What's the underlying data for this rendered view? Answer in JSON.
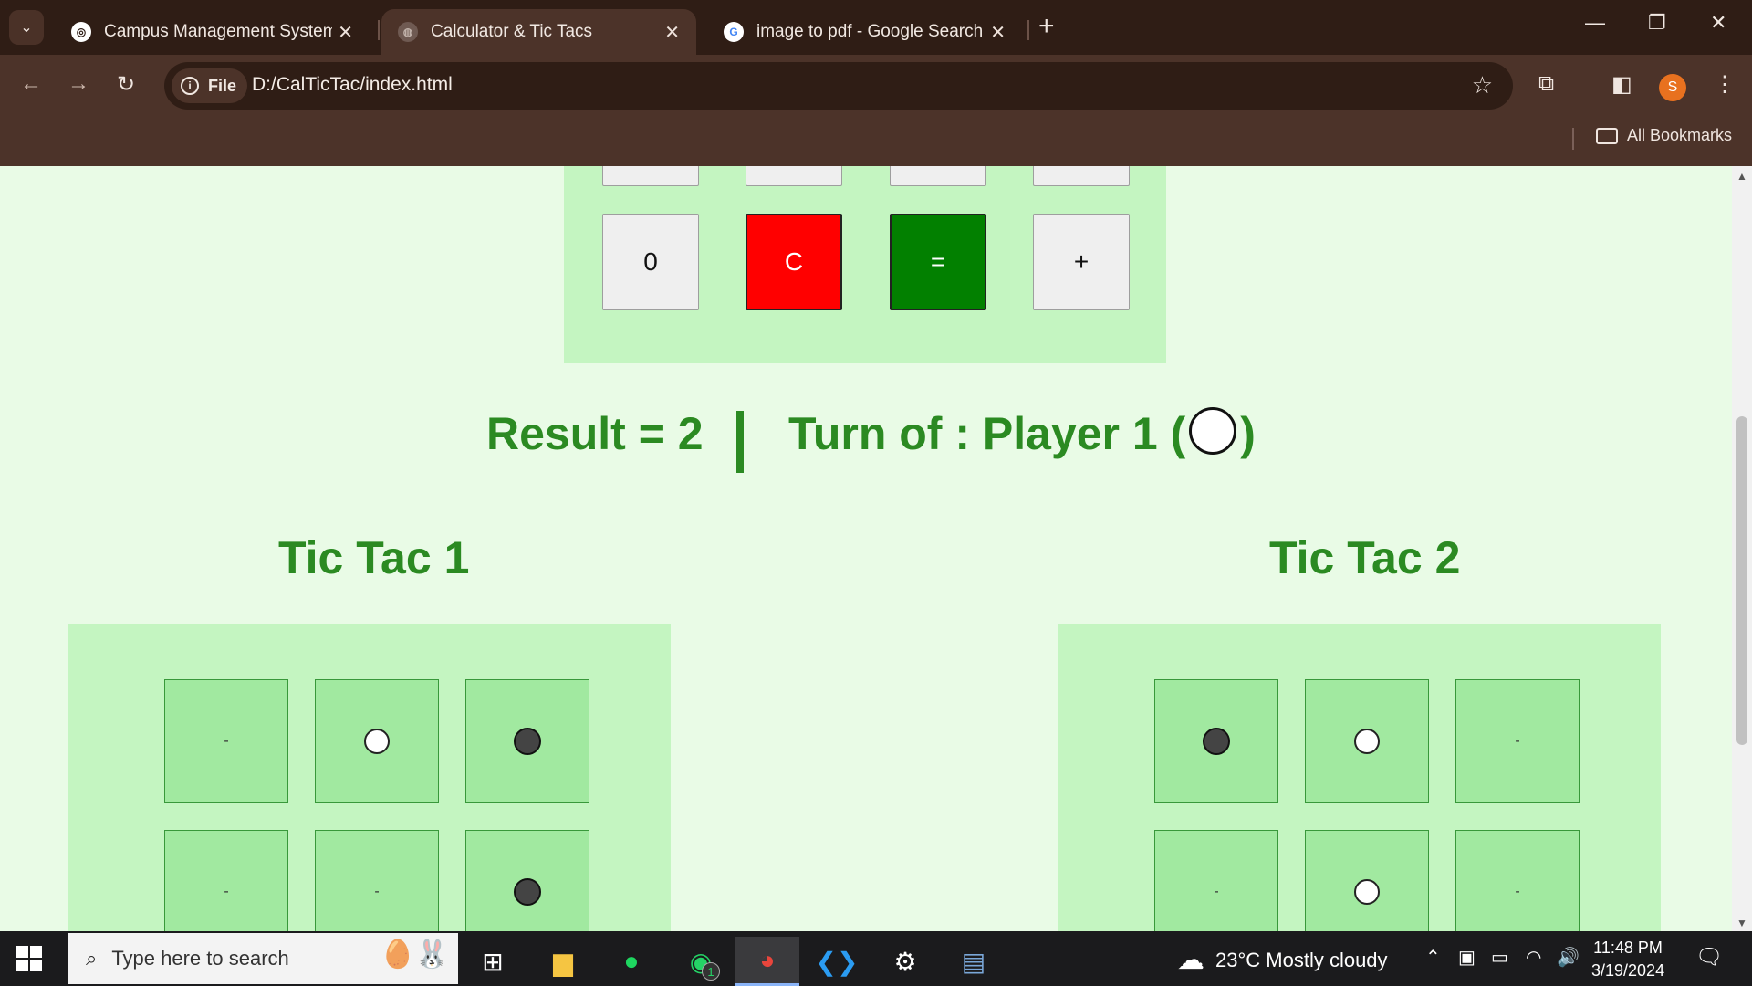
{
  "browser": {
    "tabs": [
      {
        "title": "Campus Management System -",
        "favicon": "campus-logo-icon",
        "active": false
      },
      {
        "title": "Calculator & Tic Tacs",
        "favicon": "globe-icon",
        "active": true
      },
      {
        "title": "image to pdf - Google Search",
        "favicon": "google-icon",
        "active": false
      }
    ],
    "new_tab_label": "+",
    "security_chip": "File",
    "url": "D:/CalTicTac/index.html",
    "profile_initial": "S",
    "bookmarks_label": "All Bookmarks"
  },
  "calculator": {
    "top_row": [
      "",
      "",
      "",
      ""
    ],
    "bottom_row": [
      {
        "label": "0",
        "style": "default"
      },
      {
        "label": "C",
        "style": "red"
      },
      {
        "label": "=",
        "style": "green"
      },
      {
        "label": "+",
        "style": "default"
      }
    ]
  },
  "status": {
    "result": "Result = 2",
    "turn_prefix": "Turn of : Player 1 (",
    "turn_suffix": ")"
  },
  "tictac1": {
    "title": "Tic Tac 1",
    "cells": [
      "-",
      "O",
      "X",
      "-",
      "-",
      "X"
    ]
  },
  "tictac2": {
    "title": "Tic Tac 2",
    "cells": [
      "X",
      "O",
      "-",
      "-",
      "O",
      "-"
    ]
  },
  "taskbar": {
    "search_placeholder": "Type here to search",
    "whatsapp_badge": "1",
    "weather": "23°C  Mostly cloudy",
    "time": "11:48 PM",
    "date": "3/19/2024"
  },
  "colors": {
    "accent_green": "#2b8a22",
    "board_bg": "#c4f5c1",
    "cell_bg": "#a1e9a0",
    "clear_btn": "#ff0000",
    "equals_btn": "#028000"
  }
}
